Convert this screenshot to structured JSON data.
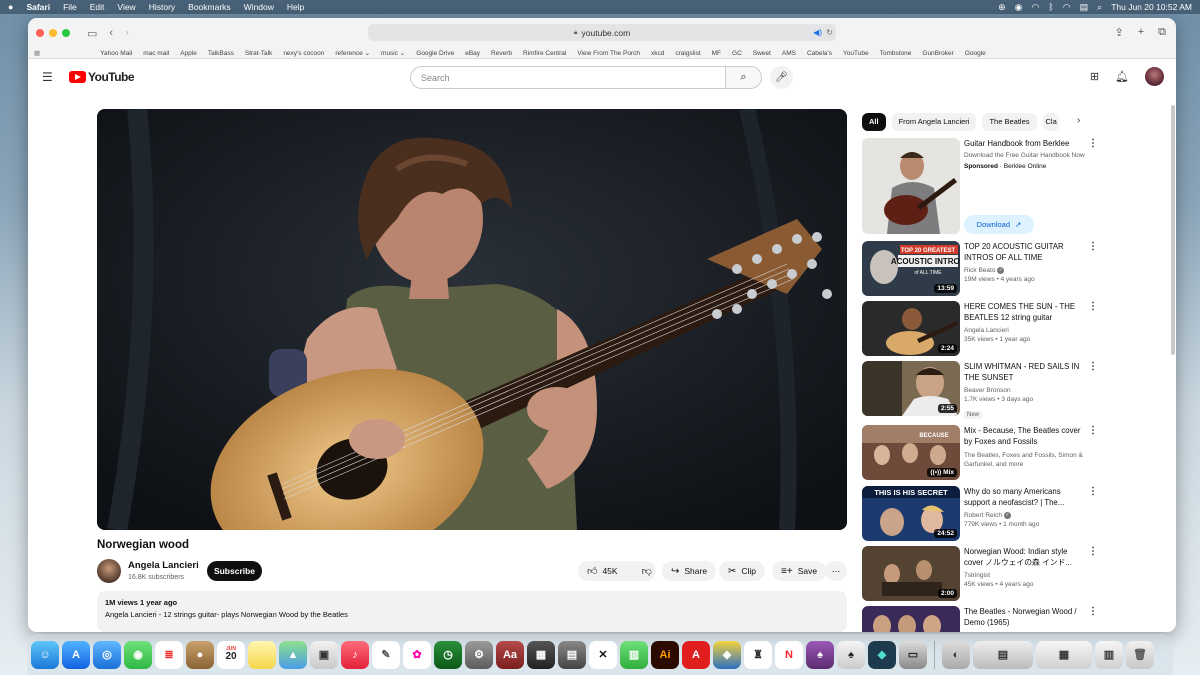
{
  "menubar": {
    "apple": "",
    "app": "Safari",
    "items": [
      "File",
      "Edit",
      "View",
      "History",
      "Bookmarks",
      "Window",
      "Help"
    ],
    "clock": "Thu Jun 20  10:52 AM"
  },
  "browser": {
    "url": "youtube.com",
    "bookmarks": [
      "Yahoo Mail",
      "mac mail",
      "Apple",
      "TalkBass",
      "Strat-Talk",
      "nexy's cocoon",
      "reference ⌄",
      "music ⌄",
      "Google Drive",
      "eBay",
      "Reverb",
      "Rimfire Central",
      "View From The Porch",
      "xkcd",
      "craigslist",
      "MF",
      "GC",
      "Sweet",
      "AMS",
      "Cabela's",
      "YouTube",
      "Tombstone",
      "GunBroker",
      "Google"
    ]
  },
  "youtube": {
    "logo": "YouTube",
    "search_placeholder": "Search",
    "video": {
      "title": "Norwegian wood",
      "channel": "Angela Lancieri",
      "subscribers": "16.8K subscribers",
      "subscribe_label": "Subscribe",
      "likes": "45K",
      "share_label": "Share",
      "clip_label": "Clip",
      "save_label": "Save",
      "views_date": "1M views  1 year ago",
      "description": "Angela Lancieri - 12 strings guitar-  plays Norwegian Wood by the Beatles"
    },
    "chips": [
      "All",
      "From Angela Lancieri",
      "The Beatles",
      "Cla"
    ],
    "ad": {
      "title": "Guitar Handbook from Berklee",
      "description": "Download the Free Guitar Handbook Now",
      "sponsored": "Sponsored",
      "advertiser": "Berklee Online",
      "button": "Download"
    },
    "recommendations": [
      {
        "title": "TOP 20 ACOUSTIC GUITAR INTROS OF ALL TIME",
        "channel": "Rick Beato",
        "verified": true,
        "meta": "19M views • 4 years ago",
        "duration": "13:59",
        "thumb_text": "TOP 20 GREATEST ACOUSTIC INTROS of ALL TIME"
      },
      {
        "title": "HERE COMES THE SUN - THE BEATLES 12 string guitar",
        "channel": "Angela Lancieri",
        "verified": false,
        "meta": "35K views • 1 year ago",
        "duration": "2:24",
        "thumb_text": ""
      },
      {
        "title": "SLIM WHITMAN - RED SAILS IN THE SUNSET",
        "channel": "Beaver Bronson",
        "verified": false,
        "meta": "1.7K views • 3 days ago",
        "duration": "2:55",
        "badge": "New",
        "thumb_text": ""
      },
      {
        "title": "Mix - Because, The Beatles cover by Foxes and Fossils",
        "channel": "The Beatles, Foxes and Fossils, Simon & Garfunkel, and more",
        "verified": false,
        "meta": "",
        "duration": "Mix",
        "thumb_text": "BECAUSE"
      },
      {
        "title": "Why do so many Americans support a neofascist? | The...",
        "channel": "Robert Reich",
        "verified": true,
        "meta": "779K views • 1 month ago",
        "duration": "24:52",
        "thumb_text": "THIS IS HIS SECRET"
      },
      {
        "title": "Norwegian Wood: Indian style cover ノルウェイの森 インド...",
        "channel": "7stringist",
        "verified": false,
        "meta": "45K views • 4 years ago",
        "duration": "2:00",
        "thumb_text": ""
      },
      {
        "title": "The Beatles - Norwegian Wood / Demo (1965)",
        "channel": "",
        "verified": false,
        "meta": "",
        "duration": "",
        "thumb_text": ""
      }
    ]
  },
  "dock": {
    "calendar_month": "JUN",
    "calendar_day": "20"
  }
}
